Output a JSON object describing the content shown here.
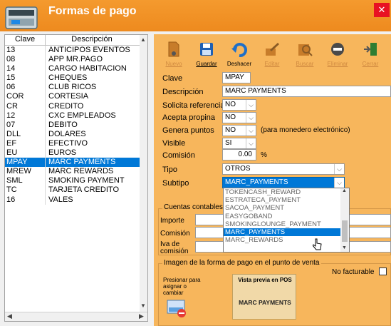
{
  "window": {
    "title": "Formas de pago",
    "close_glyph": "✕"
  },
  "list": {
    "headers": {
      "clave": "Clave",
      "descripcion": "Descripción"
    },
    "rows": [
      {
        "clave": "13",
        "descripcion": "ANTICIPOS EVENTOS",
        "selected": false
      },
      {
        "clave": "08",
        "descripcion": "APP MR.PAGO",
        "selected": false
      },
      {
        "clave": "14",
        "descripcion": "CARGO HABITACION",
        "selected": false
      },
      {
        "clave": "15",
        "descripcion": "CHEQUES",
        "selected": false
      },
      {
        "clave": "06",
        "descripcion": "CLUB RICOS",
        "selected": false
      },
      {
        "clave": "COR",
        "descripcion": "CORTESIA",
        "selected": false
      },
      {
        "clave": "CR",
        "descripcion": "CREDITO",
        "selected": false
      },
      {
        "clave": "12",
        "descripcion": "CXC EMPLEADOS",
        "selected": false
      },
      {
        "clave": "07",
        "descripcion": "DEBITO",
        "selected": false
      },
      {
        "clave": "DLL",
        "descripcion": "DOLARES",
        "selected": false
      },
      {
        "clave": "EF",
        "descripcion": "EFECTIVO",
        "selected": false
      },
      {
        "clave": "EU",
        "descripcion": "EUROS",
        "selected": false
      },
      {
        "clave": "MPAY",
        "descripcion": "MARC PAYMENTS",
        "selected": true
      },
      {
        "clave": "MREW",
        "descripcion": "MARC REWARDS",
        "selected": false
      },
      {
        "clave": "SML",
        "descripcion": "SMOKING PAYMENT",
        "selected": false
      },
      {
        "clave": "TC",
        "descripcion": "TARJETA CREDITO",
        "selected": false
      },
      {
        "clave": "16",
        "descripcion": "VALES",
        "selected": false
      }
    ]
  },
  "toolbar": {
    "nuevo": "Nuevo",
    "guardar": "Guardar",
    "deshacer": "Deshacer",
    "editar": "Editar",
    "buscar": "Buscar",
    "eliminar": "Eliminar",
    "cerrar": "Cerrar"
  },
  "form": {
    "clave": {
      "label": "Clave",
      "value": "MPAY"
    },
    "descripcion": {
      "label": "Descripción",
      "value": "MARC PAYMENTS"
    },
    "solicita_referencia": {
      "label": "Solicita referencia",
      "value": "NO"
    },
    "acepta_propina": {
      "label": "Acepta propina",
      "value": "NO"
    },
    "genera_puntos": {
      "label": "Genera puntos",
      "value": "NO",
      "note": "(para monedero electrónico)"
    },
    "visible": {
      "label": "Visible",
      "value": "SI"
    },
    "comision": {
      "label": "Comisión",
      "value": "0.00",
      "unit": "%"
    },
    "tipo": {
      "label": "Tipo",
      "value": "OTROS"
    },
    "subtipo": {
      "label": "Subtipo",
      "value": "MARC_PAYMENTS"
    }
  },
  "subtipo_dropdown": [
    {
      "label": "TOKENCASH_REWARD",
      "selected": false
    },
    {
      "label": "ESTRATECA_PAYMENT",
      "selected": false
    },
    {
      "label": "SACOA_PAYMENT",
      "selected": false
    },
    {
      "label": "EASYGOBAND",
      "selected": false
    },
    {
      "label": "SMOKINGLOUNGE_PAYMENT",
      "selected": false
    },
    {
      "label": "MARC_PAYMENTS",
      "selected": true
    },
    {
      "label": "MARC_REWARDS",
      "selected": false
    }
  ],
  "cuentas": {
    "title": "Cuentas contables",
    "importe": "Importe",
    "comision": "Comisión",
    "iva_comision_1": "Iva de",
    "iva_comision_2": "comisión"
  },
  "imagen": {
    "title": "Imagen de la forma de pago en el punto de venta",
    "instr_1": "Presionar para",
    "instr_2": "asignar o",
    "instr_3": "cambiar",
    "preview_title": "Vista previa en POS",
    "preview_text": "MARC PAYMENTS",
    "no_facturable": "No facturable"
  },
  "colors": {
    "accent": "#ee8a1e",
    "panel": "#f7b65c",
    "selection": "#0078d7",
    "close": "#e81123"
  }
}
